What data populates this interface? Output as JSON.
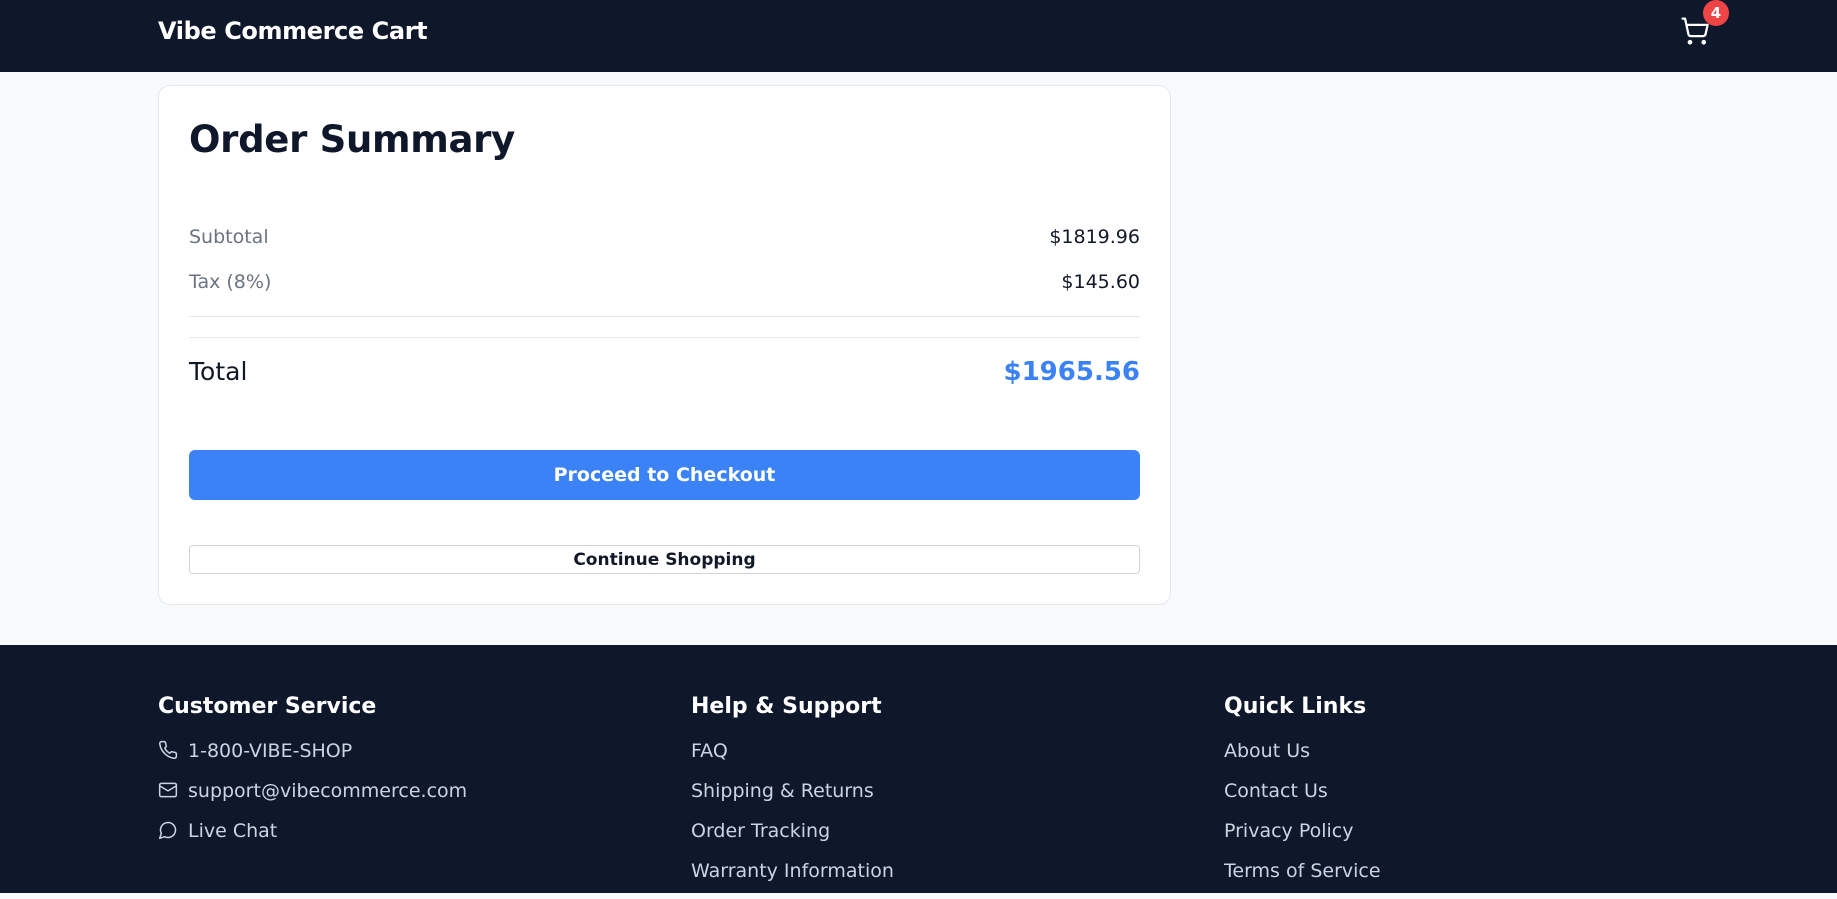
{
  "header": {
    "brand": "Vibe Commerce Cart",
    "cart_count": "4"
  },
  "summary": {
    "title": "Order Summary",
    "subtotal_label": "Subtotal",
    "subtotal_value": "$1819.96",
    "tax_label": "Tax (8%)",
    "tax_value": "$145.60",
    "total_label": "Total",
    "total_value": "$1965.56",
    "checkout_label": "Proceed to Checkout",
    "continue_label": "Continue Shopping"
  },
  "footer": {
    "customer_service": {
      "heading": "Customer Service",
      "items": [
        {
          "icon": "phone-icon",
          "label": "1-800-VIBE-SHOP"
        },
        {
          "icon": "mail-icon",
          "label": "support@vibecommerce.com"
        },
        {
          "icon": "chat-icon",
          "label": "Live Chat"
        }
      ]
    },
    "help_support": {
      "heading": "Help & Support",
      "items": [
        "FAQ",
        "Shipping & Returns",
        "Order Tracking",
        "Warranty Information"
      ]
    },
    "quick_links": {
      "heading": "Quick Links",
      "items": [
        "About Us",
        "Contact Us",
        "Privacy Policy",
        "Terms of Service"
      ]
    }
  },
  "colors": {
    "nav_background": "#0f172a",
    "accent": "#3b82f6",
    "badge": "#ef4444"
  }
}
